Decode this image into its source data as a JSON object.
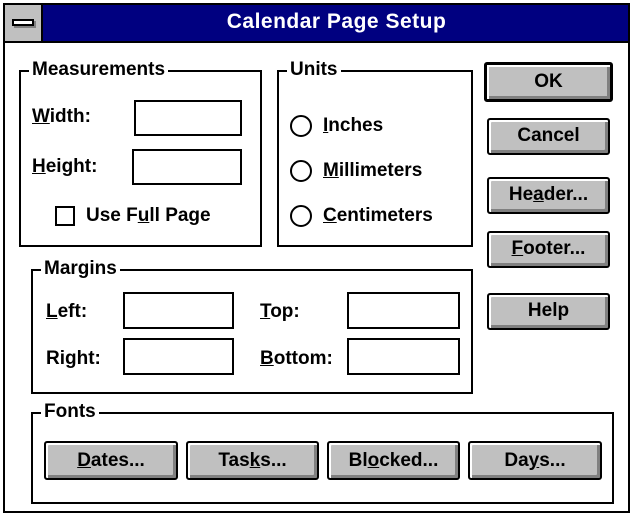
{
  "window": {
    "title": "Calendar Page Setup"
  },
  "measurements": {
    "group_label": "Measurements",
    "width_label_u": "W",
    "width_label_rest": "idth:",
    "height_label_u": "H",
    "height_label_rest": "eight:",
    "width_value": "",
    "height_value": "",
    "full_page_pre": "Use F",
    "full_page_u": "u",
    "full_page_post": "ll Page",
    "full_page_checked": false
  },
  "units": {
    "group_label": "Units",
    "options": [
      {
        "u": "I",
        "rest": "nches"
      },
      {
        "u": "M",
        "rest": "illimeters"
      },
      {
        "u": "C",
        "rest": "entimeters"
      }
    ],
    "selected": null
  },
  "margins": {
    "group_label": "Margins",
    "left_u": "L",
    "left_rest": "eft:",
    "right_pre": "Ri",
    "right_u": "g",
    "right_post": "ht:",
    "top_u": "T",
    "top_rest": "op:",
    "bottom_u": "B",
    "bottom_rest": "ottom:",
    "left_value": "",
    "right_value": "",
    "top_value": "",
    "bottom_value": ""
  },
  "fonts": {
    "group_label": "Fonts",
    "dates_u": "D",
    "dates_rest": "ates...",
    "tasks_pre": "Tas",
    "tasks_u": "k",
    "tasks_post": "s...",
    "blocked_pre": "Bl",
    "blocked_u": "o",
    "blocked_post": "cked...",
    "days_pre": "Da",
    "days_u": "y",
    "days_post": "s..."
  },
  "buttons": {
    "ok": "OK",
    "cancel": "Cancel",
    "header_pre": "He",
    "header_u": "a",
    "header_post": "der...",
    "footer_u": "F",
    "footer_rest": "ooter...",
    "help": "Help"
  },
  "colors": {
    "titlebar": "#000080",
    "face": "#c0c0c0",
    "background": "#ffffff"
  }
}
